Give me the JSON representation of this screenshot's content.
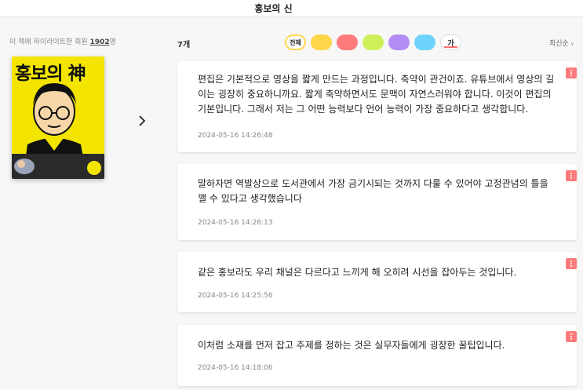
{
  "header": {
    "title": "홍보의 신"
  },
  "sidebar": {
    "members_prefix": "이 책에 하이라이트한 회원 ",
    "members_count": "1902",
    "members_suffix": "명",
    "book": {
      "cover_title": "홍보의 神",
      "cover_color": "#f3e500"
    },
    "next_icon": "chevron-right-icon"
  },
  "toolbar": {
    "count": "7개",
    "filters": [
      {
        "label": "전체",
        "color": "#ffffff"
      },
      {
        "label": "",
        "color": "#ffd54a"
      },
      {
        "label": "",
        "color": "#ff7b7b"
      },
      {
        "label": "",
        "color": "#cdf05a"
      },
      {
        "label": "",
        "color": "#b38cf5"
      },
      {
        "label": "",
        "color": "#6fd3ff"
      },
      {
        "label": "가",
        "color": "#ffffff"
      }
    ],
    "sort": "최신순"
  },
  "highlights": [
    {
      "text": "편집은 기본적으로 영상을 짧게 만드는 과정입니다. 축약이 관건이죠. 유튜브에서 영상의 길이는 굉장히 중요하니까요. 짧게 축약하면서도 문맥이 자연스러워야 합니다. 이것이 편집의 기본입니다. 그래서 저는 그 어떤 능력보다 언어 능력이 가장 중요하다고 생각합니다.",
      "date": "2024-05-16 14:26:48"
    },
    {
      "text": "말하자면 역발상으로 도서관에서 가장 금기시되는 것까지 다룰 수 있어야 고정관념의 틀을 깰 수 있다고 생각했습니다",
      "date": "2024-05-16 14:26:13"
    },
    {
      "text": "같은 홍보라도 우리 채널은 다르다고 느끼게 해 오히려 시선을 잡아두는 것입니다.",
      "date": "2024-05-16 14:25:56"
    },
    {
      "text": "이처럼 소재를 먼저 잡고 주제를 정하는 것은 실무자들에게 굉장한 꿀팁입니다.",
      "date": "2024-05-16 14:18:06"
    }
  ]
}
